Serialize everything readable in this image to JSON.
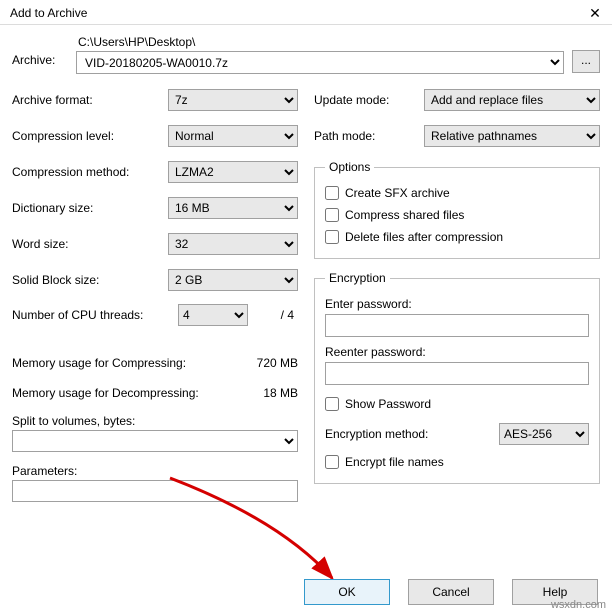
{
  "title": "Add to Archive",
  "archive": {
    "label": "Archive:",
    "path": "C:\\Users\\HP\\Desktop\\",
    "filename": "VID-20180205-WA0010.7z",
    "browse": "..."
  },
  "left": {
    "format": {
      "label": "Archive format:",
      "value": "7z"
    },
    "level": {
      "label": "Compression level:",
      "value": "Normal"
    },
    "method": {
      "label": "Compression method:",
      "value": "LZMA2"
    },
    "dict": {
      "label": "Dictionary size:",
      "value": "16 MB"
    },
    "word": {
      "label": "Word size:",
      "value": "32"
    },
    "block": {
      "label": "Solid Block size:",
      "value": "2 GB"
    },
    "cpu": {
      "label": "Number of CPU threads:",
      "value": "4",
      "total": "/ 4"
    },
    "mem_comp": {
      "label": "Memory usage for Compressing:",
      "value": "720 MB"
    },
    "mem_decomp": {
      "label": "Memory usage for Decompressing:",
      "value": "18 MB"
    },
    "split": {
      "label": "Split to volumes, bytes:"
    },
    "params": {
      "label": "Parameters:"
    }
  },
  "right": {
    "update": {
      "label": "Update mode:",
      "value": "Add and replace files"
    },
    "pathmode": {
      "label": "Path mode:",
      "value": "Relative pathnames"
    },
    "options": {
      "legend": "Options",
      "sfx": "Create SFX archive",
      "shared": "Compress shared files",
      "delete": "Delete files after compression"
    },
    "encryption": {
      "legend": "Encryption",
      "enter": "Enter password:",
      "reenter": "Reenter password:",
      "show": "Show Password",
      "method_label": "Encryption method:",
      "method_value": "AES-256",
      "encrypt_names": "Encrypt file names"
    }
  },
  "buttons": {
    "ok": "OK",
    "cancel": "Cancel",
    "help": "Help"
  },
  "watermark": "wsxdn.com"
}
